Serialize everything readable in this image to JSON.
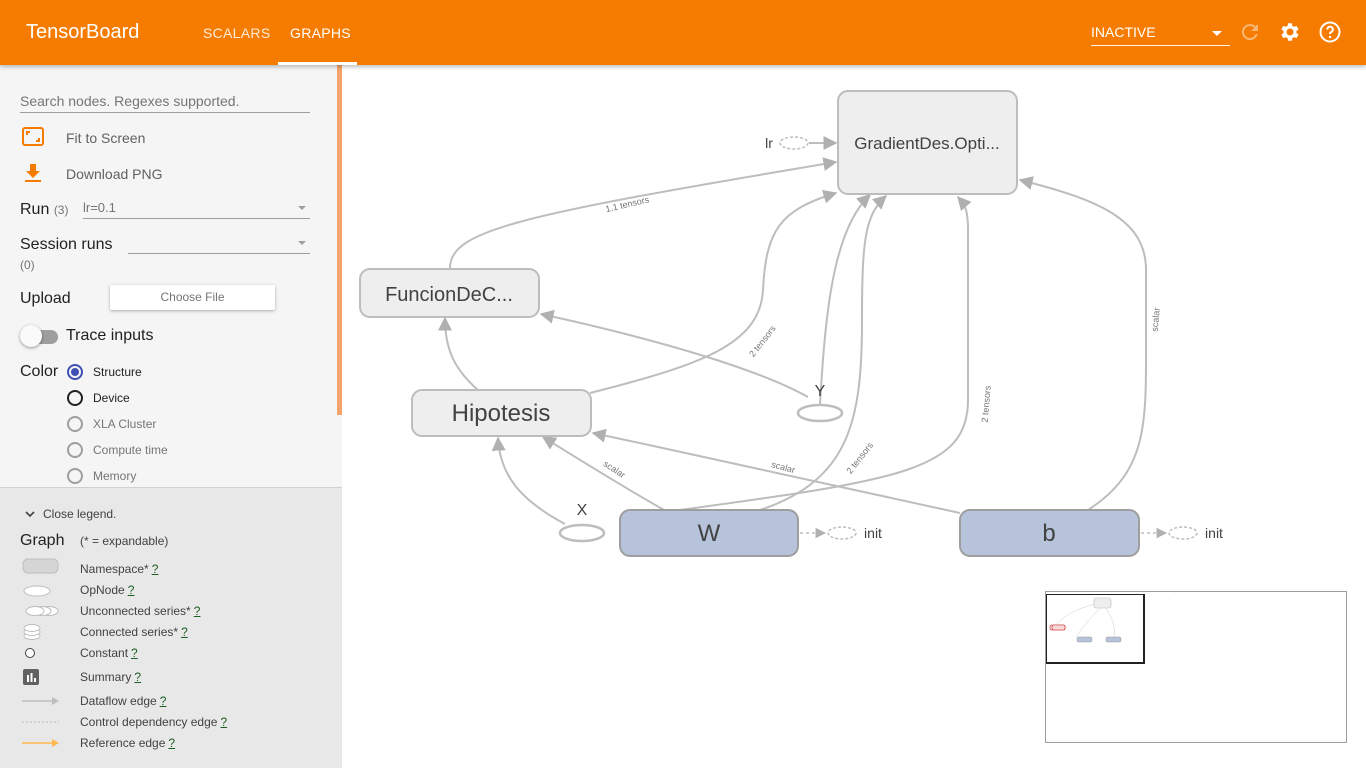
{
  "app": {
    "title": "TensorBoard",
    "tabs": [
      {
        "label": "SCALARS"
      },
      {
        "label": "GRAPHS"
      }
    ],
    "run_selector": {
      "value": "INACTIVE"
    }
  },
  "sidebar": {
    "search_placeholder": "Search nodes. Regexes supported.",
    "fit_label": "Fit to Screen",
    "download_label": "Download PNG",
    "run": {
      "label": "Run",
      "count": "(3)",
      "value": "lr=0.1"
    },
    "session": {
      "label": "Session runs",
      "count": "(0)",
      "value": ""
    },
    "upload": {
      "label": "Upload",
      "button": "Choose File"
    },
    "trace_label": "Trace inputs",
    "color": {
      "label": "Color",
      "options": [
        {
          "label": "Structure",
          "selected": true
        },
        {
          "label": "Device",
          "selected": false
        },
        {
          "label": "XLA Cluster",
          "selected": false
        },
        {
          "label": "Compute time",
          "selected": false
        },
        {
          "label": "Memory",
          "selected": false
        }
      ]
    }
  },
  "legend": {
    "close_label": "Close legend.",
    "graph_label": "Graph",
    "expandable_note": "(* = expandable)",
    "items": [
      {
        "label": "Namespace*",
        "help": "?"
      },
      {
        "label": "OpNode",
        "help": "?"
      },
      {
        "label": "Unconnected series*",
        "help": "?"
      },
      {
        "label": "Connected series*",
        "help": "?"
      },
      {
        "label": "Constant",
        "help": "?"
      },
      {
        "label": "Summary",
        "help": "?"
      },
      {
        "label": "Dataflow edge",
        "help": "?"
      },
      {
        "label": "Control dependency edge",
        "help": "?"
      },
      {
        "label": "Reference edge",
        "help": "?"
      }
    ]
  },
  "graph": {
    "nodes": {
      "gradient": "GradientDes.Opti...",
      "funcion": "FuncionDeC...",
      "hipotesis": "Hipotesis",
      "w": "W",
      "b": "b",
      "x": "X",
      "y": "Y",
      "lr": "lr",
      "init_w": "init",
      "init_b": "init"
    },
    "edge_labels": {
      "e1": "1.1 tensors",
      "e2": "2 tensors",
      "e3": "2 tensors",
      "e4": "2 tensors",
      "e5": "scalar",
      "e6": "scalar",
      "e7": "scalar"
    }
  },
  "colors": {
    "header": "#f57c00",
    "namespace_fill": "#eeeeee",
    "variable_fill": "#b6c3db",
    "accent": "#3f51b5"
  }
}
